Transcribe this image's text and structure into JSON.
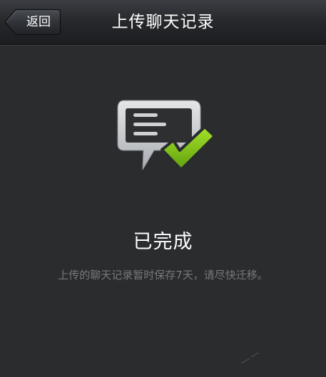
{
  "header": {
    "back_label": "返回",
    "title": "上传聊天记录"
  },
  "status": {
    "icon": "chat-record-check-icon",
    "heading": "已完成",
    "note": "上传的聊天记录暂时保存7天，请尽快迁移。"
  },
  "colors": {
    "background": "#2b2c2e",
    "titlebar": "#202225",
    "check_green": "#7ec11c",
    "note_text": "#77797c"
  },
  "icons": {
    "back": "back-arrow-button",
    "success": "chat-bubble-checkmark-icon"
  }
}
